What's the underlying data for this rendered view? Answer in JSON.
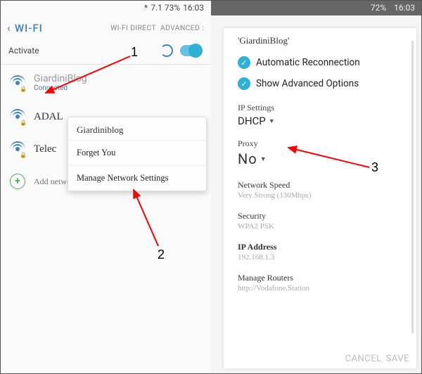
{
  "left": {
    "status": {
      "bt": "*",
      "battery": "7.1 73%",
      "time": "16:03"
    },
    "header": {
      "title": "WI-FI",
      "direct": "WI-FI DIRECT",
      "advanced": "ADVANCED"
    },
    "activate": "Activate",
    "networks": [
      {
        "name": "GiardiniBlog",
        "status": "Connected"
      },
      {
        "name": "ADAL"
      },
      {
        "name": "Telec"
      }
    ],
    "add": "Add network",
    "menu": {
      "title": "Giardiniblog",
      "forget": "Forget You",
      "manage": "Manage Network Settings"
    }
  },
  "right": {
    "status": {
      "battery": "72%",
      "time": "16:03"
    },
    "title": "'GiardiniBlog'",
    "auto": "Automatic Reconnection",
    "adv": "Show Advanced Options",
    "ip_lbl": "IP Settings",
    "ip_val": "DHCP",
    "proxy_lbl": "Proxy",
    "proxy_val": "No",
    "speed_lbl": "Network Speed",
    "speed_val": "Very Strong (130Mbps)",
    "sec_lbl": "Security",
    "sec_val": "WPA2 PSK",
    "ipaddr_lbl": "IP Address",
    "ipaddr_val": "192.168.1.3",
    "routers_lbl": "Manage Routers",
    "routers_val": "http://Vodafone.Station",
    "cancel": "CANCEL",
    "save": "SAVE"
  },
  "annot": {
    "n1": "1",
    "n2": "2",
    "n3": "3"
  }
}
